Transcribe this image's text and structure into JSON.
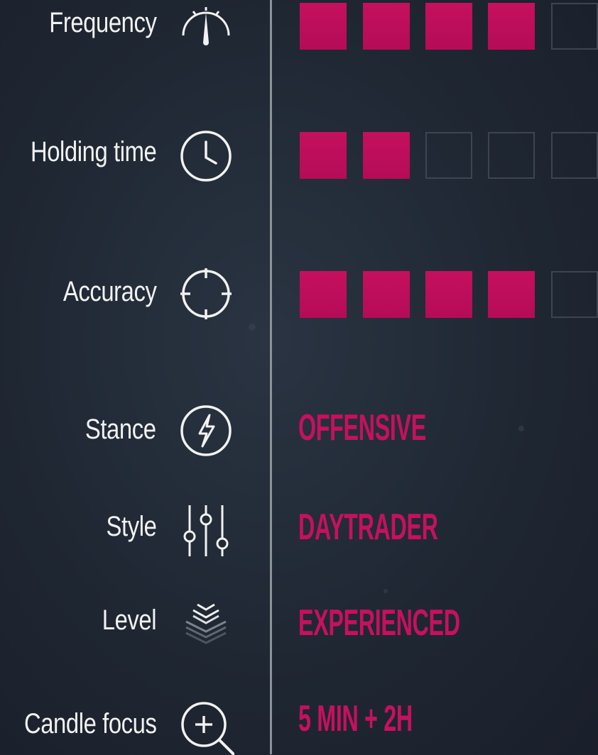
{
  "rows": [
    {
      "label": "Frequency",
      "icon": "speedometer-icon",
      "rating": 4,
      "max": 5
    },
    {
      "label": "Holding time",
      "icon": "clock-icon",
      "rating": 2,
      "max": 5
    },
    {
      "label": "Accuracy",
      "icon": "crosshair-icon",
      "rating": 4,
      "max": 5
    }
  ],
  "attributes": [
    {
      "label": "Stance",
      "icon": "lightning-icon",
      "value": "OFFENSIVE"
    },
    {
      "label": "Style",
      "icon": "sliders-icon",
      "value": "DAYTRADER"
    },
    {
      "label": "Level",
      "icon": "layers-icon",
      "value": "EXPERIENCED"
    },
    {
      "label": "Candle focus",
      "icon": "zoom-in-icon",
      "value": "5 MIN + 2H"
    }
  ],
  "colors": {
    "accent": "#c7105f",
    "background": "#1f2733",
    "text": "#f2f2f2",
    "empty_square_border": "#3e4550"
  }
}
